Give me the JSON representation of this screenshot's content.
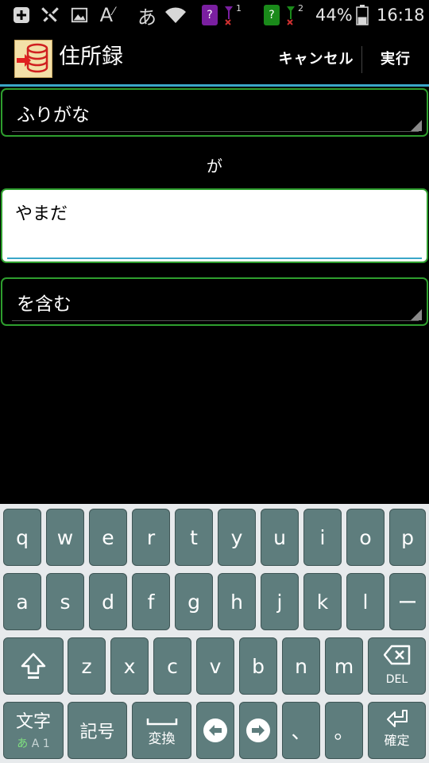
{
  "status_bar": {
    "icons": [
      "add-box-icon",
      "settings-icon",
      "image-icon",
      "font-icon",
      "ime-icon",
      "wifi-icon",
      "sim1-icon",
      "signal1-icon",
      "sim2-icon",
      "signal2-icon",
      "battery-icon"
    ],
    "ime_char": "あ",
    "font_char": "A",
    "sim1_label": "?",
    "sim2_label": "?",
    "signal1_index": "1",
    "signal2_index": "2",
    "battery_percent": "44%",
    "battery_level": 0.44,
    "time": "16:18",
    "colors": {
      "sim1": "#7a1fa0",
      "sim2": "#1a8a1a"
    }
  },
  "action_bar": {
    "title": "住所録",
    "cancel_label": "キャンセル",
    "execute_label": "実行",
    "accent": "#3aa6c8"
  },
  "form": {
    "field_spinner": {
      "value": "ふりがな"
    },
    "conjunction": "が",
    "search_text": {
      "value": "やまだ"
    },
    "match_spinner": {
      "value": "を含む"
    },
    "border_color": "#2e9e2e"
  },
  "keyboard": {
    "row1": [
      "q",
      "w",
      "e",
      "r",
      "t",
      "y",
      "u",
      "i",
      "o",
      "p"
    ],
    "row2": [
      "a",
      "s",
      "d",
      "f",
      "g",
      "h",
      "j",
      "k",
      "l",
      "ー"
    ],
    "row3": [
      "z",
      "x",
      "c",
      "v",
      "b",
      "n",
      "m"
    ],
    "delete_label": "DEL",
    "mode_label": "文字",
    "mode_sub_kana": "あ",
    "mode_sub_rest": "A 1",
    "symbol_label": "記号",
    "space_label": "変換",
    "comma": "、",
    "period": "。",
    "enter_label": "確定",
    "key_color": "#5e7d7d"
  }
}
